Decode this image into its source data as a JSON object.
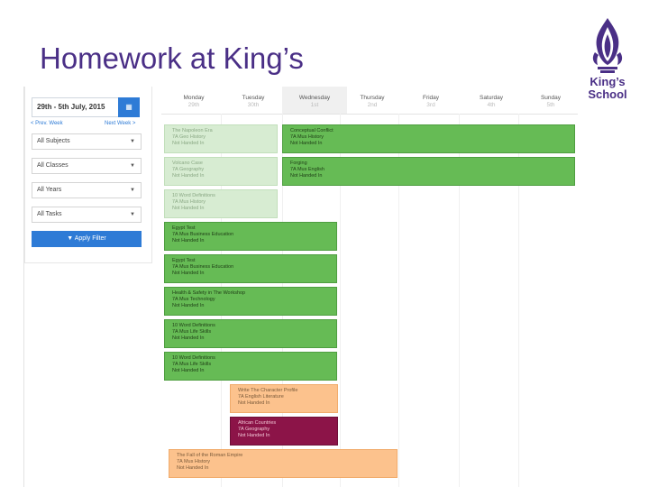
{
  "slide": {
    "title": "Homework at King’s"
  },
  "logo": {
    "line1": "King’s",
    "line2": "School",
    "color": "#4a2f86"
  },
  "sidebar": {
    "date_range": "29th - 5th July, 2015",
    "calendar_icon": "calendar-icon",
    "prev_week": "< Prev. Week",
    "next_week": "Next Week >",
    "filters": [
      {
        "label": "All Subjects"
      },
      {
        "label": "All Classes"
      },
      {
        "label": "All Years"
      },
      {
        "label": "All Tasks"
      }
    ],
    "apply_label": "▼ Apply Filter"
  },
  "calendar": {
    "days": [
      {
        "name": "Monday",
        "num": "29th"
      },
      {
        "name": "Tuesday",
        "num": "30th"
      },
      {
        "name": "Wednesday",
        "num": "1st"
      },
      {
        "name": "Thursday",
        "num": "2nd"
      },
      {
        "name": "Friday",
        "num": "3rd"
      },
      {
        "name": "Saturday",
        "num": "4th"
      },
      {
        "name": "Sunday",
        "num": "5th"
      }
    ],
    "active_day": "Wednesday",
    "events": [
      {
        "title": "The Napoleon Era",
        "cls": "7A Geo History",
        "status": "Not Handed In"
      },
      {
        "title": "Conceptual Conflict",
        "cls": "7A Mus History",
        "status": "Not Handed In"
      },
      {
        "title": "Volcano Case",
        "cls": "7A Geography",
        "status": "Not Handed In"
      },
      {
        "title": "Forging",
        "cls": "7A Mus English",
        "status": "Not Handed In"
      },
      {
        "title": "10 Word Definitions",
        "cls": "7A Mus History",
        "status": "Not Handed In"
      },
      {
        "title": "Egypt Test",
        "cls": "7A Mus Business Education",
        "status": "Not Handed In"
      },
      {
        "title": "Egypt Test",
        "cls": "7A Mus Business Education",
        "status": "Not Handed In"
      },
      {
        "title": "Health & Safety in The Workshop",
        "cls": "7A Mus Technology",
        "status": "Not Handed In"
      },
      {
        "title": "10 Word Definitions",
        "cls": "7A Mus Life Skills",
        "status": "Not Handed In"
      },
      {
        "title": "10 Word Definitions",
        "cls": "7A Mus Life Skills",
        "status": "Not Handed In"
      },
      {
        "title": "Write The Character Profile",
        "cls": "7A English Literature",
        "status": "Not Handed In"
      },
      {
        "title": "African Countries",
        "cls": "7A Geography",
        "status": "Not Handed In"
      },
      {
        "title": "The Fall of the Roman Empire",
        "cls": "7A Mus History",
        "status": "Not Handed In"
      }
    ]
  }
}
